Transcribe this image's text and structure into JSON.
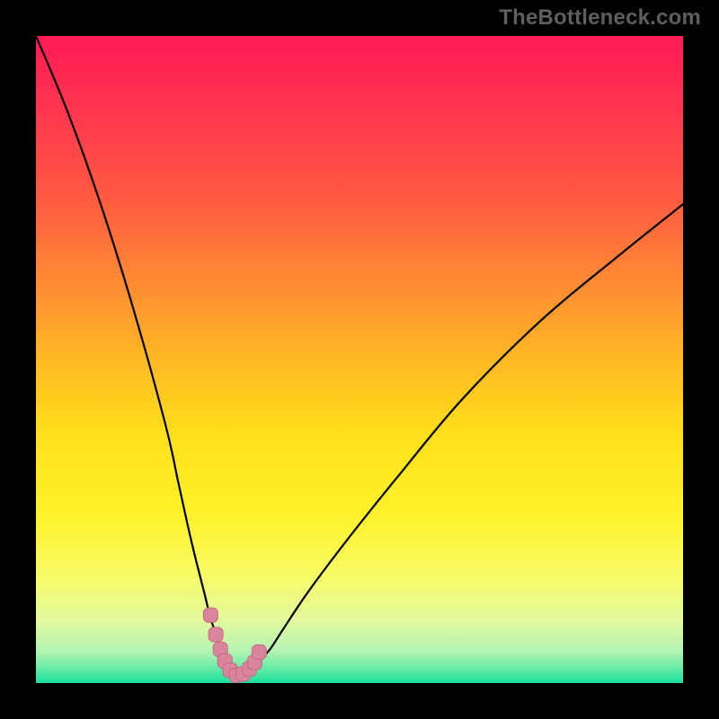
{
  "watermark": "TheBottleneck.com",
  "colors": {
    "black": "#000000",
    "stroke": "#000000",
    "marker_fill": "#d9869c",
    "marker_stroke": "#c56b84",
    "grad_stops": [
      {
        "offset": 0.0,
        "color": "#ff1a55"
      },
      {
        "offset": 0.12,
        "color": "#ff374f"
      },
      {
        "offset": 0.25,
        "color": "#ff5a42"
      },
      {
        "offset": 0.38,
        "color": "#ff8a33"
      },
      {
        "offset": 0.5,
        "color": "#ffb824"
      },
      {
        "offset": 0.62,
        "color": "#ffe11a"
      },
      {
        "offset": 0.74,
        "color": "#fff22a"
      },
      {
        "offset": 0.83,
        "color": "#f8fc63"
      },
      {
        "offset": 0.9,
        "color": "#e6fa9c"
      },
      {
        "offset": 0.95,
        "color": "#b6f4b2"
      },
      {
        "offset": 0.98,
        "color": "#5fe9a8"
      },
      {
        "offset": 1.0,
        "color": "#16e09a"
      }
    ]
  },
  "chart_data": {
    "type": "line",
    "title": "",
    "xlabel": "",
    "ylabel": "",
    "xlim": [
      0,
      100
    ],
    "ylim": [
      0,
      100
    ],
    "series": [
      {
        "name": "bottleneck-curve",
        "x": [
          0,
          5,
          10,
          15,
          20,
          22,
          24,
          26,
          27,
          28,
          29,
          30,
          31,
          32,
          33,
          34,
          36,
          38,
          42,
          48,
          56,
          66,
          78,
          90,
          100
        ],
        "values": [
          100,
          88,
          74,
          58,
          40,
          31,
          22,
          14,
          10,
          7,
          4,
          2,
          1,
          1,
          2,
          3,
          5,
          8,
          14,
          22,
          32,
          44,
          56,
          66,
          74
        ]
      }
    ],
    "markers": {
      "name": "highlight-near-minimum",
      "x": [
        27.0,
        27.8,
        28.5,
        29.2,
        30.0,
        31.0,
        32.0,
        33.0,
        33.8,
        34.5
      ],
      "values": [
        10.5,
        7.5,
        5.2,
        3.4,
        2.0,
        1.2,
        1.4,
        2.2,
        3.2,
        4.8
      ]
    }
  }
}
